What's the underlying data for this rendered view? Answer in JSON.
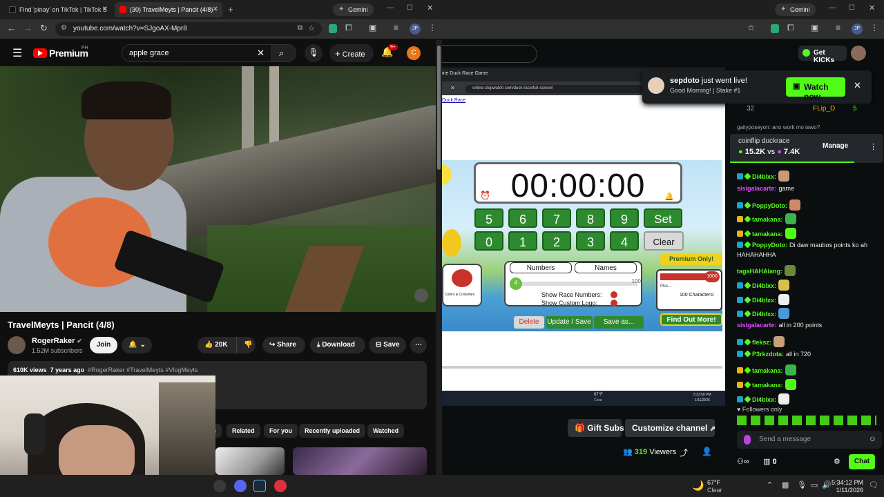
{
  "left_browser": {
    "tabs": [
      {
        "title": "Find 'pinay' on TikTok | TikTok S"
      },
      {
        "title": "(30) TravelMeyts | Pancit (4/8) -"
      }
    ],
    "gemini_label": "Gemini",
    "url": "youtube.com/watch?v=SJgoAX-Mpr8",
    "profile": "JP"
  },
  "youtube": {
    "logo": "Premium",
    "region": "PH",
    "search_value": "apple grace",
    "create_label": "Create",
    "notif_badge": "9+",
    "avatar_letter": "C",
    "video_title": "TravelMeyts | Pancit (4/8)",
    "channel": "RogerRaker",
    "subscribers": "1.52M subscribers",
    "join_label": "Join",
    "likes": "20K",
    "share_label": "Share",
    "download_label": "Download",
    "save_label": "Save",
    "description": {
      "views": "610K views",
      "age": "7 years ago",
      "hashtags": "#RogerRaker #TravelMeyts #VlogMeyts"
    },
    "chips": [
      "s",
      "Related",
      "For you",
      "Recently uploaded",
      "Watched"
    ]
  },
  "right_browser": {
    "gemini_label": "Gemini",
    "profile": "JP"
  },
  "kick": {
    "get_kicks": "Get KICKs",
    "notification": {
      "user": "sepdoto",
      "text": "just went live!",
      "subtitle": "Good Morning! | Stake #1",
      "button": "Watch now"
    },
    "stream_game": {
      "inner_tab": "ine Duck Race Game",
      "inner_url": "online-stopwatch.com/duck-race/full-screen/",
      "link": "Duck Race",
      "timer": "00:00:00",
      "keys_row1": [
        "5",
        "6",
        "7",
        "8",
        "9"
      ],
      "keys_row2": [
        "0",
        "1",
        "2",
        "3",
        "4"
      ],
      "set": "Set",
      "clear": "Clear",
      "numbers_label": "Numbers",
      "names_label": "Names",
      "slider_value": "4",
      "slider_max": "100",
      "show_race_numbers": "Show Race Numbers:",
      "show_custom_logo": "Show Custom Logo:",
      "colors_label": "Colors & Costumes",
      "delete": "Delete",
      "update_save": "Update / Save",
      "save_as": "Save as...",
      "premium_only": "Premium Only!",
      "plus_label": "Plus...",
      "hundred_chars": "100 Characters!",
      "thousand": "1000",
      "find_out": "Find Out More!",
      "mini_weather": "67°F",
      "mini_weather2": "Clear",
      "mini_time": "5:33:50 PM",
      "mini_date": "1/11/2026"
    },
    "gift_subs": "Gift Subs",
    "customize": "Customize channel",
    "viewers_count": "319",
    "viewers_label": "Viewers"
  },
  "chat": {
    "top_count": "32",
    "top_user": "FLip_D",
    "top_user_count": "5",
    "cut_line": "gaiiyposeyon: ano work mo iawo?",
    "poll": {
      "title": "coinflip duckrace",
      "left": "15.2K",
      "vs": "vs",
      "right": "7.4K",
      "manage": "Manage"
    },
    "messages": [
      {
        "user": "Di4blxx:",
        "text": "",
        "color": "#53fc18",
        "badge": "#1aa5c8",
        "emote": "#c99a7a"
      },
      {
        "user": "sisigalacarte:",
        "text": "game",
        "color": "#e04aff",
        "badge": "",
        "emote": ""
      },
      {
        "user": "PoppyDoto:",
        "text": "",
        "color": "#53fc18",
        "badge": "#1aa5c8",
        "emote": "#d08a6a"
      },
      {
        "user": "tamakana:",
        "text": "",
        "color": "#53fc18",
        "badge": "#e8b21a",
        "emote": "#3ab54a"
      },
      {
        "user": "tamakana:",
        "text": "",
        "color": "#53fc18",
        "badge": "#e8b21a",
        "emote": "#53fc18"
      },
      {
        "user": "PoppyDoto:",
        "text": "Di daw maubos points ko ah",
        "color": "#53fc18",
        "badge": "#1aa5c8",
        "emote": ""
      },
      {
        "user": "",
        "text": "HAHAHAHHA",
        "color": "#fff",
        "badge": "",
        "emote": ""
      },
      {
        "user": "tagaHAHAlang:",
        "text": "",
        "color": "#53fc18",
        "badge": "",
        "emote": "#6a8a3a"
      },
      {
        "user": "Di4blxx:",
        "text": "",
        "color": "#53fc18",
        "badge": "#1aa5c8",
        "emote": "#d8c04a"
      },
      {
        "user": "Di4blxx:",
        "text": "",
        "color": "#53fc18",
        "badge": "#1aa5c8",
        "emote": "#eeeeee"
      },
      {
        "user": "Di4blxx:",
        "text": "",
        "color": "#53fc18",
        "badge": "#1aa5c8",
        "emote": "#4a9ad8"
      },
      {
        "user": "sisigalacarte:",
        "text": "all in 200 points",
        "color": "#e04aff",
        "badge": "",
        "emote": ""
      },
      {
        "user": "fleksz:",
        "text": "",
        "color": "#53fc18",
        "badge": "#1aa5c8",
        "emote": "#c8a07a"
      },
      {
        "user": "P3rkzdota:",
        "text": "all in 720",
        "color": "#53fc18",
        "badge": "#1aa5c8",
        "emote": ""
      },
      {
        "user": "tamakana:",
        "text": "",
        "color": "#53fc18",
        "badge": "#e8b21a",
        "emote": "#3ab54a"
      },
      {
        "user": "tamakana:",
        "text": "",
        "color": "#53fc18",
        "badge": "#e8b21a",
        "emote": "#53fc18"
      },
      {
        "user": "Di4blxx:",
        "text": "",
        "color": "#53fc18",
        "badge": "#1aa5c8",
        "emote": "#eeeeee"
      }
    ],
    "followers_only": "Followers only",
    "send_placeholder": "Send a message",
    "points": "0",
    "chat_button": "Chat"
  },
  "taskbar": {
    "weather_temp": "67°F",
    "weather_desc": "Clear",
    "time": "5:34:12 PM",
    "date": "1/11/2026"
  },
  "colors": {
    "kick_green": "#53fc18",
    "yt_red": "#ff0000",
    "bg": "#0f0f0f"
  }
}
